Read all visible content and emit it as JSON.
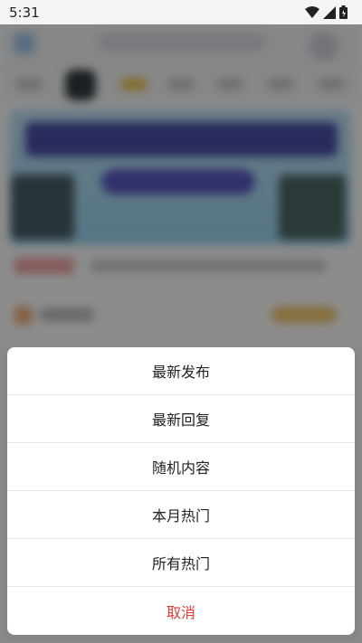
{
  "status_bar": {
    "time": "5:31",
    "icons": [
      "wifi-icon",
      "signal-icon",
      "battery-icon"
    ]
  },
  "action_sheet": {
    "items": [
      {
        "label": "最新发布"
      },
      {
        "label": "最新回复"
      },
      {
        "label": "随机内容"
      },
      {
        "label": "本月热门"
      },
      {
        "label": "所有热门"
      }
    ],
    "cancel_label": "取消"
  },
  "colors": {
    "cancel": "#e53935",
    "overlay": "rgba(0,0,0,0.45)",
    "sheet_background": "#ffffff"
  }
}
